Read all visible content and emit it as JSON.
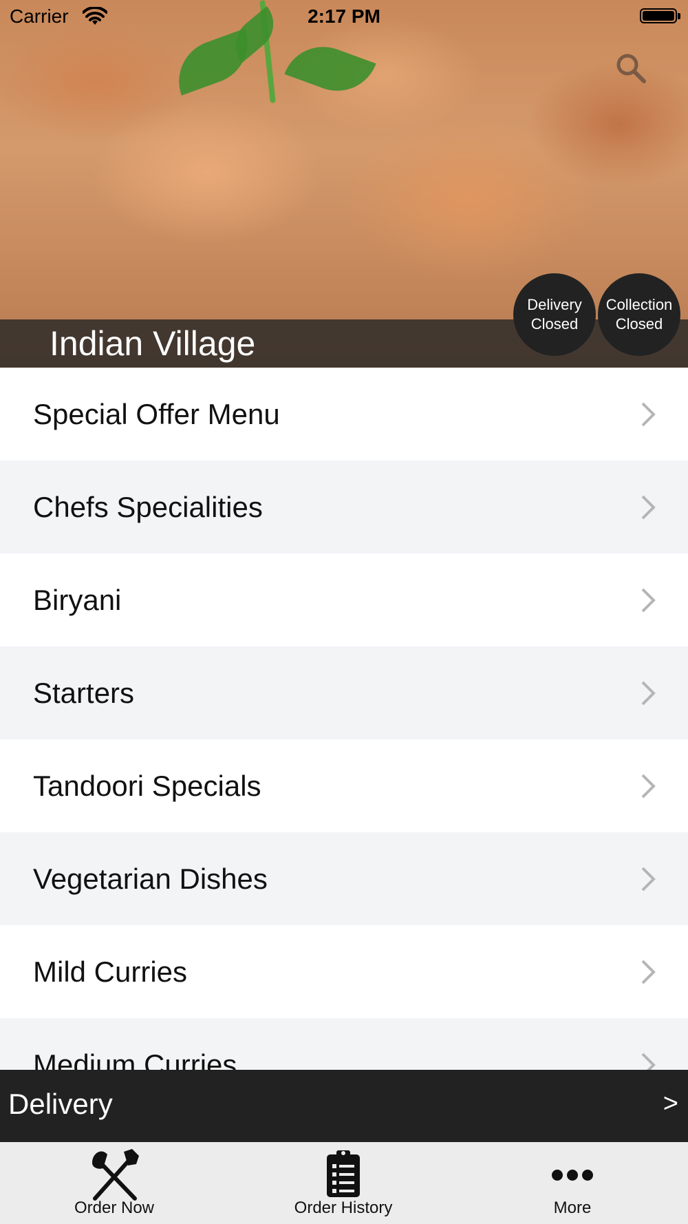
{
  "status_bar": {
    "carrier": "Carrier",
    "time": "2:17 PM"
  },
  "header": {
    "restaurant_name": "Indian Village",
    "delivery_status": {
      "line1": "Delivery",
      "line2": "Closed"
    },
    "collection_status": {
      "line1": "Collection",
      "line2": "Closed"
    },
    "search_icon": "search-icon"
  },
  "menu": {
    "items": [
      {
        "label": "Special Offer Menu"
      },
      {
        "label": "Chefs Specialities"
      },
      {
        "label": "Biryani"
      },
      {
        "label": "Starters"
      },
      {
        "label": "Tandoori Specials"
      },
      {
        "label": "Vegetarian Dishes"
      },
      {
        "label": "Mild Curries"
      },
      {
        "label": "Medium Curries"
      }
    ]
  },
  "delivery_bar": {
    "label": "Delivery",
    "arrow": ">"
  },
  "tab_bar": {
    "tabs": [
      {
        "label": "Order Now",
        "icon": "fork-knife-icon"
      },
      {
        "label": "Order History",
        "icon": "clipboard-list-icon"
      },
      {
        "label": "More",
        "icon": "more-dots-icon"
      }
    ]
  },
  "colors": {
    "dark_bar": "#222222",
    "row_alt": "#f3f4f6",
    "tab_bar_bg": "#ececec"
  }
}
